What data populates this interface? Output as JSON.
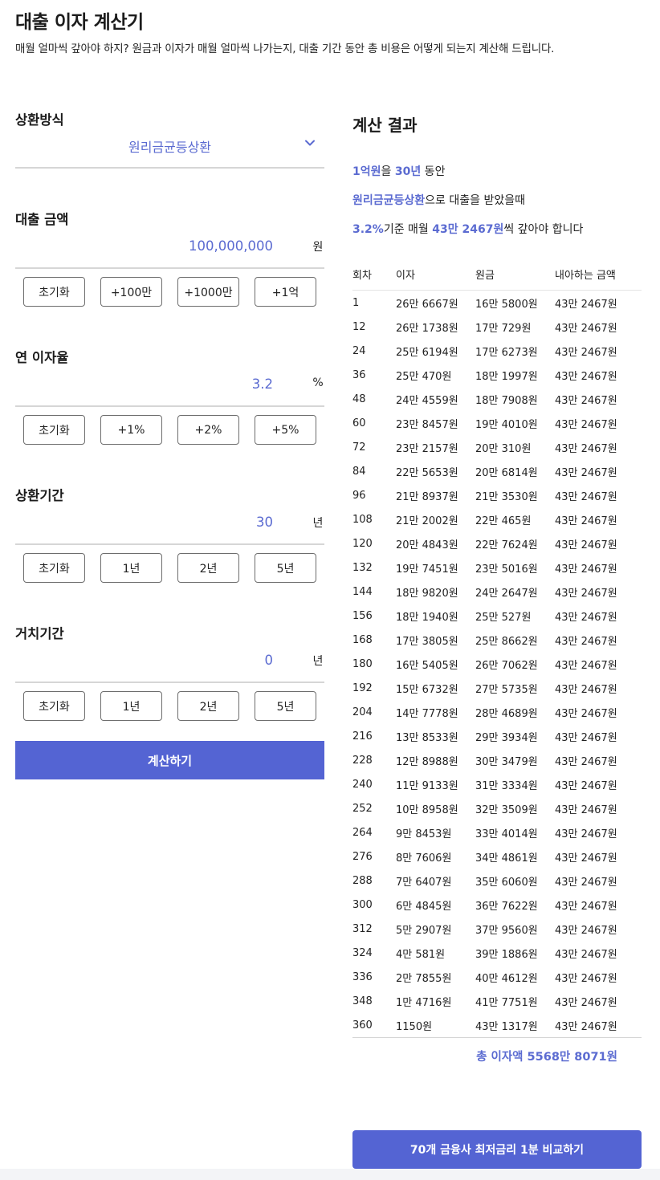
{
  "header": {
    "title": "대출 이자 계산기",
    "subtitle": "매월 얼마씩 갚아야 하지?  원금과 이자가 매월 얼마씩 나가는지, 대출 기간 동안 총 비용은 어떻게 되는지 계산해 드립니다."
  },
  "form": {
    "method": {
      "label": "상환방식",
      "value": "원리금균등상환",
      "icon": "chevron-down-icon"
    },
    "amount": {
      "label": "대출 금액",
      "value": "100,000,000",
      "unit": "원",
      "buttons": [
        "초기화",
        "+100만",
        "+1000만",
        "+1억"
      ]
    },
    "rate": {
      "label": "연 이자율",
      "value": "3.2",
      "unit": "%",
      "buttons": [
        "초기화",
        "+1%",
        "+2%",
        "+5%"
      ]
    },
    "period": {
      "label": "상환기간",
      "value": "30",
      "unit": "년",
      "buttons": [
        "초기화",
        "1년",
        "2년",
        "5년"
      ]
    },
    "grace": {
      "label": "거치기간",
      "value": "0",
      "unit": "년",
      "buttons": [
        "초기화",
        "1년",
        "2년",
        "5년"
      ]
    },
    "calc_button": "계산하기"
  },
  "result": {
    "title": "계산 결과",
    "line1": {
      "amount": "1억원",
      "t1": "을 ",
      "years": "30년",
      "t2": " 동안"
    },
    "line2": {
      "method": "원리금균등상환",
      "t1": "으로 대출을 받았을때"
    },
    "line3": {
      "rate": "3.2%",
      "t1": "기준 매월 ",
      "monthly": "43만 2467원",
      "t2": "씩 갚아야 합니다"
    },
    "table": {
      "headers": [
        "회차",
        "이자",
        "원금",
        "내아하는 금액"
      ],
      "rows": [
        [
          "1",
          "26만 6667원",
          "16만 5800원",
          "43만 2467원"
        ],
        [
          "12",
          "26만 1738원",
          "17만 729원",
          "43만 2467원"
        ],
        [
          "24",
          "25만 6194원",
          "17만 6273원",
          "43만 2467원"
        ],
        [
          "36",
          "25만 470원",
          "18만 1997원",
          "43만 2467원"
        ],
        [
          "48",
          "24만 4559원",
          "18만 7908원",
          "43만 2467원"
        ],
        [
          "60",
          "23만 8457원",
          "19만 4010원",
          "43만 2467원"
        ],
        [
          "72",
          "23만 2157원",
          "20만 310원",
          "43만 2467원"
        ],
        [
          "84",
          "22만 5653원",
          "20만 6814원",
          "43만 2467원"
        ],
        [
          "96",
          "21만 8937원",
          "21만 3530원",
          "43만 2467원"
        ],
        [
          "108",
          "21만 2002원",
          "22만 465원",
          "43만 2467원"
        ],
        [
          "120",
          "20만 4843원",
          "22만 7624원",
          "43만 2467원"
        ],
        [
          "132",
          "19만 7451원",
          "23만 5016원",
          "43만 2467원"
        ],
        [
          "144",
          "18만 9820원",
          "24만 2647원",
          "43만 2467원"
        ],
        [
          "156",
          "18만 1940원",
          "25만 527원",
          "43만 2467원"
        ],
        [
          "168",
          "17만 3805원",
          "25만 8662원",
          "43만 2467원"
        ],
        [
          "180",
          "16만 5405원",
          "26만 7062원",
          "43만 2467원"
        ],
        [
          "192",
          "15만 6732원",
          "27만 5735원",
          "43만 2467원"
        ],
        [
          "204",
          "14만 7778원",
          "28만 4689원",
          "43만 2467원"
        ],
        [
          "216",
          "13만 8533원",
          "29만 3934원",
          "43만 2467원"
        ],
        [
          "228",
          "12만 8988원",
          "30만 3479원",
          "43만 2467원"
        ],
        [
          "240",
          "11만 9133원",
          "31만 3334원",
          "43만 2467원"
        ],
        [
          "252",
          "10만 8958원",
          "32만 3509원",
          "43만 2467원"
        ],
        [
          "264",
          "9만 8453원",
          "33만 4014원",
          "43만 2467원"
        ],
        [
          "276",
          "8만 7606원",
          "34만 4861원",
          "43만 2467원"
        ],
        [
          "288",
          "7만 6407원",
          "35만 6060원",
          "43만 2467원"
        ],
        [
          "300",
          "6만 4845원",
          "36만 7622원",
          "43만 2467원"
        ],
        [
          "312",
          "5만 2907원",
          "37만 9560원",
          "43만 2467원"
        ],
        [
          "324",
          "4만 581원",
          "39만 1886원",
          "43만 2467원"
        ],
        [
          "336",
          "2만 7855원",
          "40만 4612원",
          "43만 2467원"
        ],
        [
          "348",
          "1만 4716원",
          "41만 7751원",
          "43만 2467원"
        ],
        [
          "360",
          "1150원",
          "43만 1317원",
          "43만 2467원"
        ]
      ]
    },
    "total": "총 이자액 5568만 8071원",
    "compare_button": "70개 금융사 최저금리 1분 비교하기"
  },
  "colors": {
    "accent": "#5b6bd1",
    "button": "#5464d3"
  }
}
